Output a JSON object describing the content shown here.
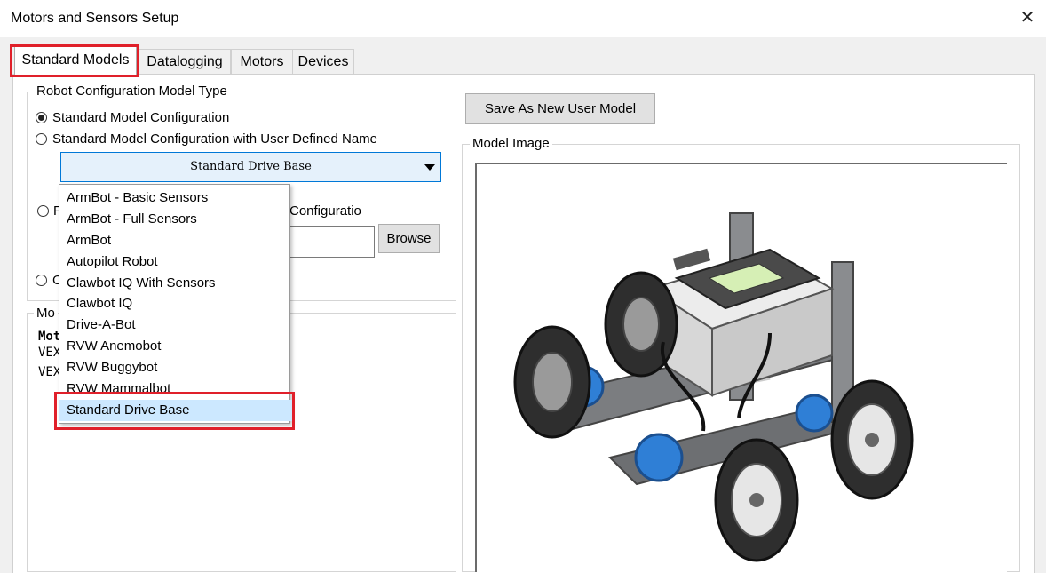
{
  "window": {
    "title": "Motors and Sensors Setup",
    "close_glyph": "✕"
  },
  "tabs": [
    "Standard Models",
    "Datalogging",
    "Motors",
    "Devices"
  ],
  "config_group": {
    "label": "Robot Configuration Model Type",
    "radio1": "Standard Model Configuration",
    "radio2": "Standard Model Configuration with User Defined Name",
    "combo_value": "Standard Drive Base",
    "radio3_fragment": "F",
    "radio3_tail": "Configuratio",
    "radio4_fragment": "C",
    "browse": "Browse"
  },
  "dropdown": {
    "items": [
      "ArmBot - Basic Sensors",
      "ArmBot - Full Sensors",
      "ArmBot",
      "Autopilot Robot",
      "Clawbot IQ With Sensors",
      "Clawbot IQ",
      "Drive-A-Bot",
      "RVW Anemobot",
      "RVW Buggybot",
      "RVW Mammalbot",
      "Standard Drive Base"
    ],
    "selected": "Standard Drive Base"
  },
  "model_group": {
    "label_fragment": "Mo",
    "lines": [
      "Mot",
      "VEX",
      "VEX"
    ]
  },
  "right": {
    "save_button": "Save As New User Model",
    "image_label": "Model Image"
  },
  "colors": {
    "accent": "#0078d7",
    "highlight": "#e0202a",
    "selection": "#cce8ff"
  }
}
